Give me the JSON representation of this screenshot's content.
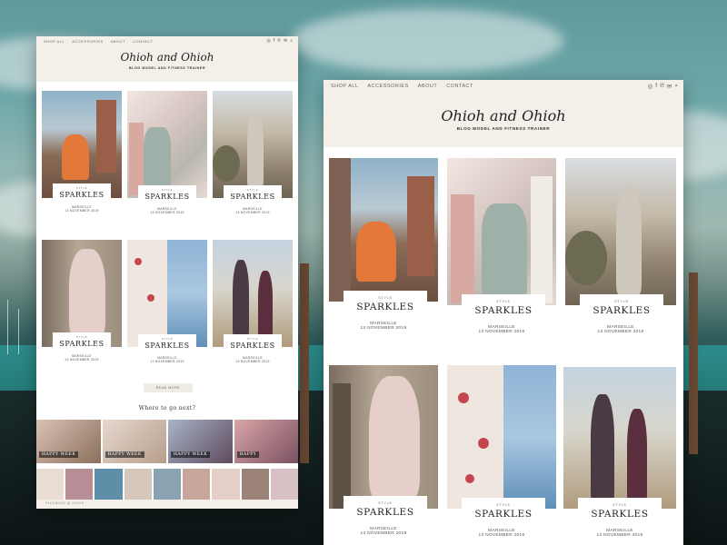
{
  "site": {
    "logo": "Ohioh and Ohioh",
    "tagline": "BLOG MODEL AND FITNESS TRAINER",
    "nav": [
      "SHOP ALL",
      "ACCESSORIES",
      "ABOUT",
      "CONTACT"
    ],
    "social_icons": [
      "instagram-icon",
      "facebook-icon",
      "pinterest-icon",
      "mail-icon",
      "search-icon"
    ]
  },
  "posts": [
    {
      "category": "STYLE",
      "title": "SPARKLES",
      "location": "MARSEILLE",
      "date": "13 NOVEMBER 2019"
    },
    {
      "category": "STYLE",
      "title": "SPARKLES",
      "location": "MARSEILLE",
      "date": "13 NOVEMBER 2019"
    },
    {
      "category": "STYLE",
      "title": "SPARKLES",
      "location": "MARSEILLE",
      "date": "13 NOVEMBER 2019"
    },
    {
      "category": "STYLE",
      "title": "SPARKLES",
      "location": "MARSEILLE",
      "date": "13 NOVEMBER 2019"
    },
    {
      "category": "STYLE",
      "title": "SPARKLES",
      "location": "MARSEILLE",
      "date": "13 NOVEMBER 2019"
    },
    {
      "category": "STYLE",
      "title": "SPARKLES",
      "location": "MARSEILLE",
      "date": "13 NOVEMBER 2019"
    }
  ],
  "read_more": "READ MORE",
  "where_next": "Where to go next?",
  "strip_tiles": [
    "HAPPY WEEK",
    "HAPPY WEEK",
    "HAPPY WEEK",
    "HAPPY"
  ],
  "instagram_label": "FACEBOOK @ OHIOH",
  "colors": {
    "header_bg": "#f4efe9",
    "accent_orange": "#e2793a"
  }
}
